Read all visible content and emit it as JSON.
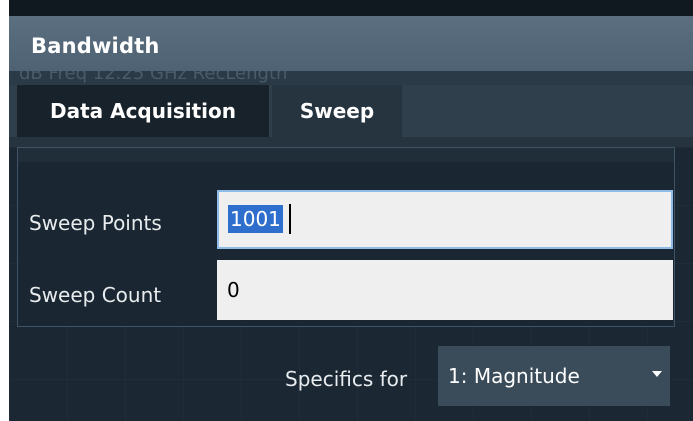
{
  "dialog": {
    "title": "Bandwidth"
  },
  "background_hint": {
    "text": "dB    Freq  12.25 GHz    RecLength"
  },
  "tabs": [
    {
      "label": "Data Acquisition",
      "active": false
    },
    {
      "label": "Sweep",
      "active": true
    }
  ],
  "sweep": {
    "points_label": "Sweep Points",
    "points_value": "1001",
    "count_label": "Sweep Count",
    "count_value": "0"
  },
  "specifics": {
    "label": "Specifics for",
    "selected": "1: Magnitude"
  },
  "colors": {
    "title_bar": "#566a7b",
    "dialog_bg": "#1b2834",
    "focus_border": "#8fbce6",
    "selection": "#2e6fce",
    "dropdown_bg": "#3a4b59"
  }
}
